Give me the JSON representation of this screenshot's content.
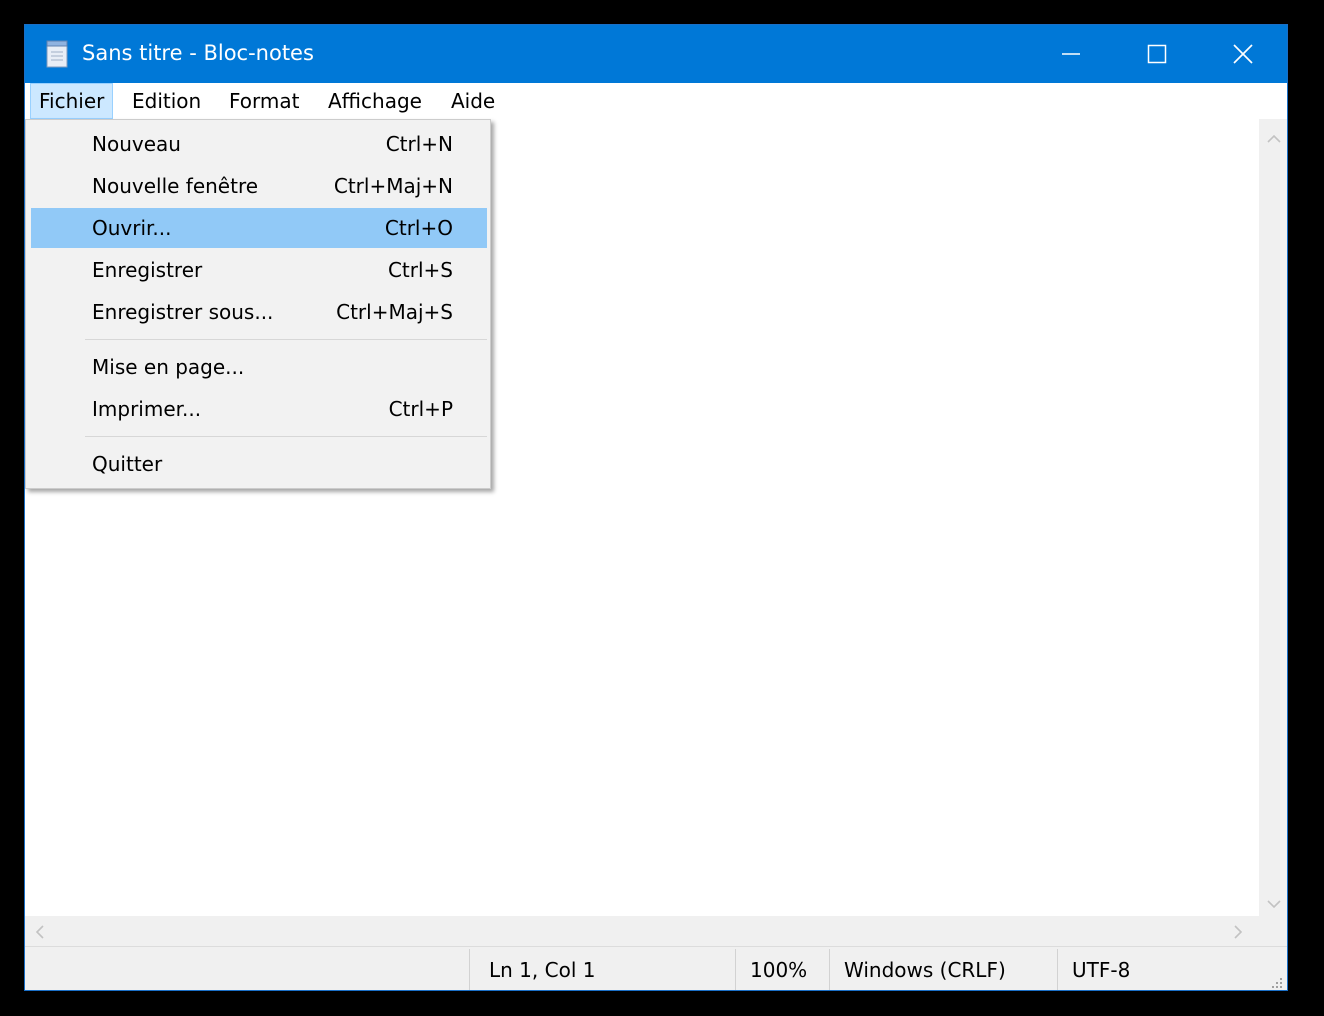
{
  "window": {
    "title": "Sans titre - Bloc-notes",
    "accent_color": "#0078d7",
    "controls": [
      "minimize-icon",
      "maximize-icon",
      "close-icon"
    ]
  },
  "menubar": {
    "items": [
      {
        "label": "Fichier",
        "active": true
      },
      {
        "label": "Edition"
      },
      {
        "label": "Format"
      },
      {
        "label": "Affichage"
      },
      {
        "label": "Aide"
      }
    ]
  },
  "file_menu": {
    "items": [
      {
        "label": "Nouveau",
        "shortcut": "Ctrl+N"
      },
      {
        "label": "Nouvelle fenêtre",
        "shortcut": "Ctrl+Maj+N"
      },
      {
        "label": "Ouvrir...",
        "shortcut": "Ctrl+O",
        "highlighted": true
      },
      {
        "label": "Enregistrer",
        "shortcut": "Ctrl+S"
      },
      {
        "label": "Enregistrer sous...",
        "shortcut": "Ctrl+Maj+S"
      },
      {
        "label": "Mise en page...",
        "shortcut": ""
      },
      {
        "label": "Imprimer...",
        "shortcut": "Ctrl+P"
      },
      {
        "label": "Quitter",
        "shortcut": ""
      }
    ],
    "highlight_color": "#91c9f7"
  },
  "editor": {
    "content": ""
  },
  "statusbar": {
    "position": "Ln 1, Col 1",
    "zoom": "100%",
    "line_ending": "Windows (CRLF)",
    "encoding": "UTF-8"
  }
}
